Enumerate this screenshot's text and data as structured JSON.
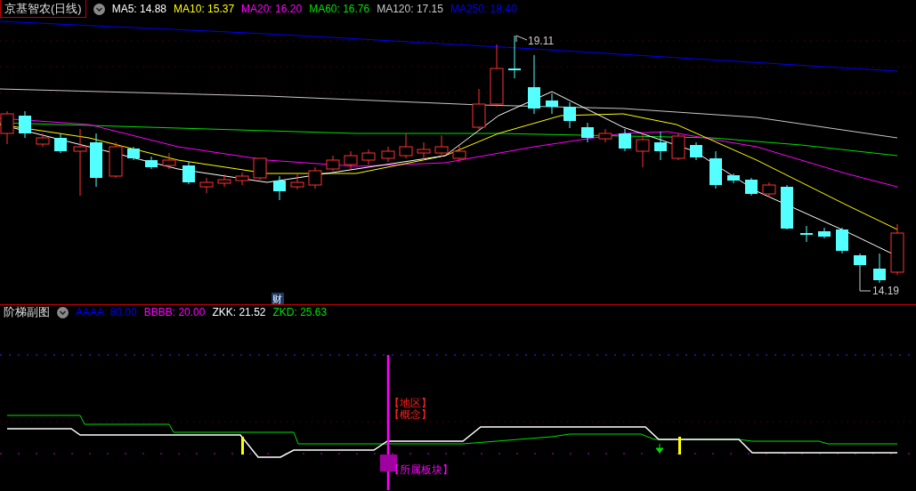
{
  "main_chart": {
    "title": "京基智农(日线)",
    "indicators": [
      {
        "text": "MA5: 14.88",
        "color": "#ffffff"
      },
      {
        "text": "MA10: 15.37",
        "color": "#ffff00"
      },
      {
        "text": "MA20: 16.20",
        "color": "#ff00ff"
      },
      {
        "text": "MA60: 16.76",
        "color": "#00e000"
      },
      {
        "text": "MA120: 17.15",
        "color": "#c8c8c8"
      },
      {
        "text": "MA250: 18.40",
        "color": "#0000ff"
      }
    ],
    "high_label": "19.11",
    "low_label": "14.19",
    "event_marker": "财"
  },
  "sub_chart": {
    "title": "阶梯副图",
    "indicators": [
      {
        "text": "AAAA: 80.00",
        "color": "#0000ff"
      },
      {
        "text": "BBBB: 20.00",
        "color": "#ff00ff"
      },
      {
        "text": "ZKK: 21.52",
        "color": "#ffffff"
      },
      {
        "text": "ZKD: 25.63",
        "color": "#00e000"
      }
    ],
    "annotations": [
      {
        "text": "【地区】",
        "color": "#ff2020"
      },
      {
        "text": "【概念】",
        "color": "#ff2020"
      },
      {
        "text": "【所属板块】",
        "color": "#ff00ff"
      }
    ]
  }
}
